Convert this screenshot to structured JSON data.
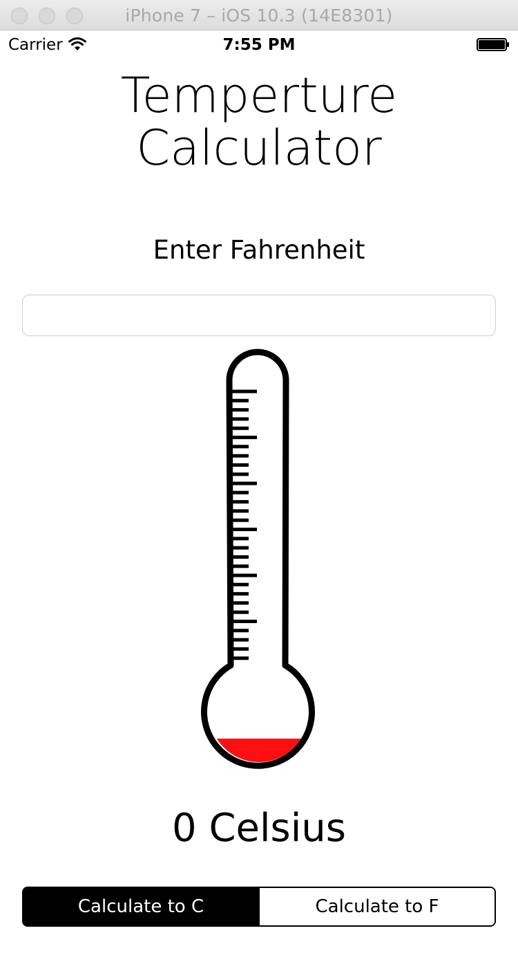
{
  "window": {
    "title": "iPhone 7 – iOS 10.3 (14E8301)"
  },
  "status_bar": {
    "carrier": "Carrier",
    "time": "7:55 PM"
  },
  "app": {
    "title_line1": "Temperture",
    "title_line2": "Calculator",
    "prompt": "Enter Fahrenheit",
    "input_value": "",
    "result": "0 Celsius",
    "thermometer_fill_color": "#ff0f12"
  },
  "segmented_control": {
    "options": [
      "Calculate to C",
      "Calculate to F"
    ],
    "selected": "Calculate to C"
  }
}
